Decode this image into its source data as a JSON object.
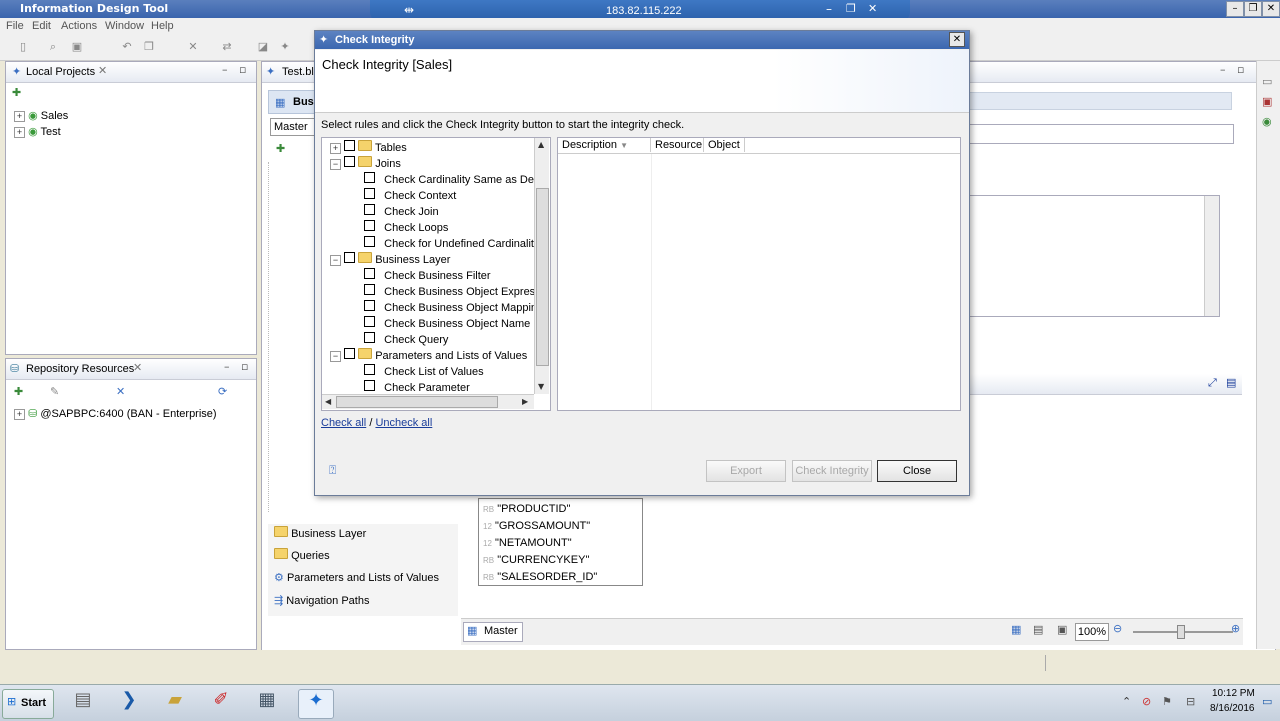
{
  "app": {
    "title": "Information Design Tool",
    "remote_host": "183.82.115.222",
    "menu": [
      "File",
      "Edit",
      "Actions",
      "Window",
      "Help"
    ]
  },
  "local_projects": {
    "tab": "Local Projects",
    "items": [
      "Sales",
      "Test"
    ]
  },
  "repository": {
    "tab": "Repository Resources",
    "items": [
      "@SAPBPC:6400 (BAN - Enterprise)"
    ]
  },
  "editor": {
    "tab": "Test.bl",
    "section_label": "Bus",
    "combo_value": "Master",
    "bottom_tab": "Master",
    "zoom": "100%",
    "nav_items": [
      "Business Layer",
      "Queries",
      "Parameters and Lists of Values",
      "Navigation Paths"
    ],
    "columns": [
      {
        "type": "RB",
        "name": "\"PRODUCTID\""
      },
      {
        "type": "12",
        "name": "\"GROSSAMOUNT\""
      },
      {
        "type": "12",
        "name": "\"NETAMOUNT\""
      },
      {
        "type": "RB",
        "name": "\"CURRENCYKEY\""
      },
      {
        "type": "RB",
        "name": "\"SALESORDER_ID\""
      }
    ]
  },
  "dialog": {
    "window_title": "Check Integrity",
    "heading": "Check Integrity [Sales]",
    "instruction": "Select rules and click the Check Integrity button to start the integrity check.",
    "rules": {
      "tables": "Tables",
      "joins": "Joins",
      "joins_items": [
        "Check Cardinality Same as Dete",
        "Check Context",
        "Check Join",
        "Check Loops",
        "Check for Undefined Cardinality"
      ],
      "business_layer": "Business Layer",
      "bl_items": [
        "Check Business Filter",
        "Check Business Object Express",
        "Check Business Object Mapping",
        "Check Business Object Name",
        "Check Query"
      ],
      "params": "Parameters and Lists of Values",
      "params_items": [
        "Check List of Values",
        "Check Parameter"
      ]
    },
    "results_columns": [
      "Description",
      "Resource",
      "Object"
    ],
    "check_all": "Check all",
    "separator": "/",
    "uncheck_all": "Uncheck all",
    "buttons": {
      "export": "Export",
      "check_integrity": "Check Integrity",
      "close": "Close"
    }
  },
  "taskbar": {
    "start": "Start",
    "time": "10:12 PM",
    "date": "8/16/2016"
  }
}
